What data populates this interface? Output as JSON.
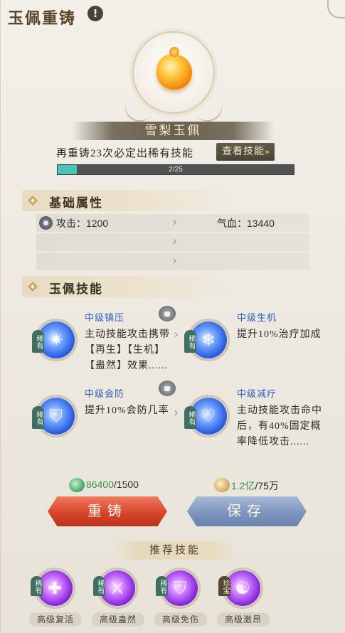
{
  "header": {
    "title": "玉佩重铸",
    "info_glyph": "!"
  },
  "item": {
    "name": "雪梨玉佩",
    "reforge_hint": "再重铸23次必定出稀有技能",
    "view_skills_label": "查看技能",
    "progress": {
      "current": 2,
      "max": 25,
      "text": "2/25"
    }
  },
  "base_attrs": {
    "title": "基础属性",
    "rows": [
      {
        "left": "攻击：",
        "left_value": "1200",
        "right": "气血：",
        "right_value": "13440"
      }
    ]
  },
  "skills": {
    "title": "玉佩技能",
    "items": [
      {
        "tag": "稀有",
        "name": "中级镇压",
        "desc": "主动技能攻击携带【再生】【生机】【蛊然】效果......",
        "color": "blue",
        "icon": "ice-shards-icon"
      },
      {
        "tag": "稀有",
        "name": "中级生机",
        "desc": "提升10%治疗加成",
        "color": "blue",
        "icon": "ice-crystal-icon"
      },
      {
        "tag": "稀有",
        "name": "中级会防",
        "desc": "提升10%会防几率",
        "color": "blue",
        "icon": "shield-icon"
      },
      {
        "tag": "稀有",
        "name": "中级减疗",
        "desc": "主动技能攻击命中后，有40%固定概率降低攻击......",
        "color": "blue",
        "icon": "heart-chain-icon"
      }
    ]
  },
  "currency": {
    "jade": {
      "have": "86400",
      "need": "/1500"
    },
    "gold": {
      "have": "1.2亿",
      "need": "/75万"
    }
  },
  "buttons": {
    "reforge": "重铸",
    "save": "保存"
  },
  "recommend": {
    "title": "推荐技能",
    "items": [
      {
        "tag": "稀有",
        "label": "高级复活",
        "icon": "cross-icon"
      },
      {
        "tag": "稀有",
        "label": "高级蛊然",
        "icon": "warrior-icon"
      },
      {
        "tag": "稀有",
        "label": "高级免伤",
        "icon": "shield-icon"
      },
      {
        "tag": "珍宝",
        "label": "高级激昂",
        "icon": "aura-icon"
      }
    ]
  },
  "colors": {
    "accent_red": "#d6462c",
    "accent_blue": "#7e95bd",
    "progress_fill": "#49c5b8",
    "skill_name": "#2f5fbf"
  }
}
